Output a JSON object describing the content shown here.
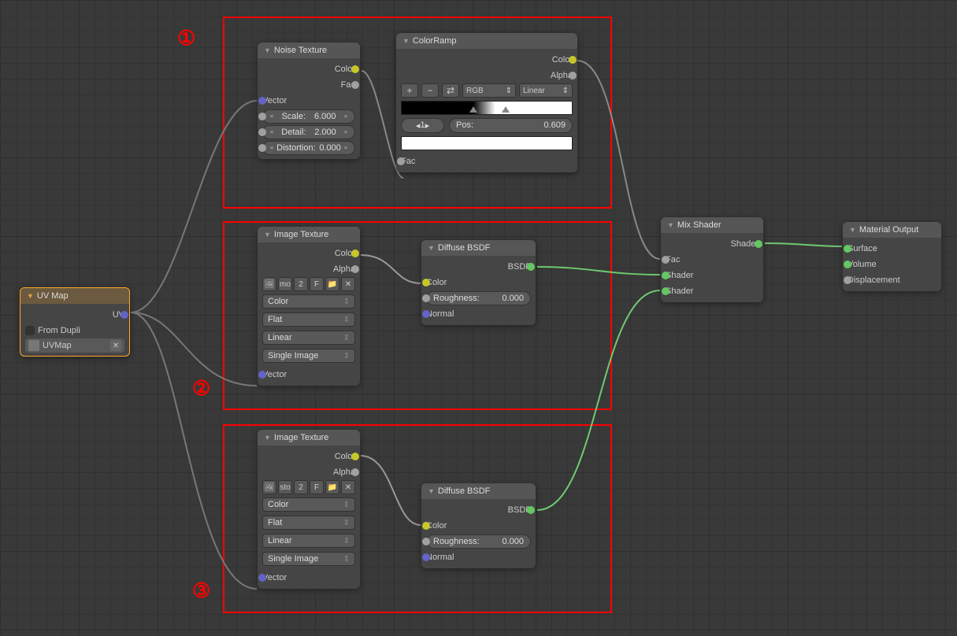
{
  "annotations": {
    "one": "①",
    "two": "②",
    "three": "③"
  },
  "uv_map": {
    "title": "UV Map",
    "out_uv": "UV",
    "from_dupli": "From Dupli",
    "map_name": "UVMap"
  },
  "noise_texture": {
    "title": "Noise Texture",
    "out_color": "Color",
    "out_fac": "Fac",
    "in_vector": "Vector",
    "scale_label": "Scale:",
    "scale_value": "6.000",
    "detail_label": "Detail:",
    "detail_value": "2.000",
    "distortion_label": "Distortion:",
    "distortion_value": "0.000"
  },
  "color_ramp": {
    "title": "ColorRamp",
    "out_color": "Color",
    "out_alpha": "Alpha",
    "mode": "RGB",
    "interp": "Linear",
    "stop_index": "1",
    "pos_label": "Pos:",
    "pos_value": "0.609",
    "in_fac": "Fac"
  },
  "image_texture_1": {
    "title": "Image Texture",
    "out_color": "Color",
    "out_alpha": "Alpha",
    "image_name": "mo",
    "users": "2",
    "fake": "F",
    "colorspace": "Color",
    "projection": "Flat",
    "interp": "Linear",
    "source": "Single Image",
    "in_vector": "Vector"
  },
  "image_texture_2": {
    "title": "Image Texture",
    "out_color": "Color",
    "out_alpha": "Alpha",
    "image_name": "sto",
    "users": "2",
    "fake": "F",
    "colorspace": "Color",
    "projection": "Flat",
    "interp": "Linear",
    "source": "Single Image",
    "in_vector": "Vector"
  },
  "diffuse_1": {
    "title": "Diffuse BSDF",
    "out_bsdf": "BSDF",
    "in_color": "Color",
    "roughness_label": "Roughness:",
    "roughness_value": "0.000",
    "in_normal": "Normal"
  },
  "diffuse_2": {
    "title": "Diffuse BSDF",
    "out_bsdf": "BSDF",
    "in_color": "Color",
    "roughness_label": "Roughness:",
    "roughness_value": "0.000",
    "in_normal": "Normal"
  },
  "mix_shader": {
    "title": "Mix Shader",
    "out_shader": "Shader",
    "in_fac": "Fac",
    "in_shader1": "Shader",
    "in_shader2": "Shader"
  },
  "material_output": {
    "title": "Material Output",
    "in_surface": "Surface",
    "in_volume": "Volume",
    "in_displacement": "Displacement"
  }
}
